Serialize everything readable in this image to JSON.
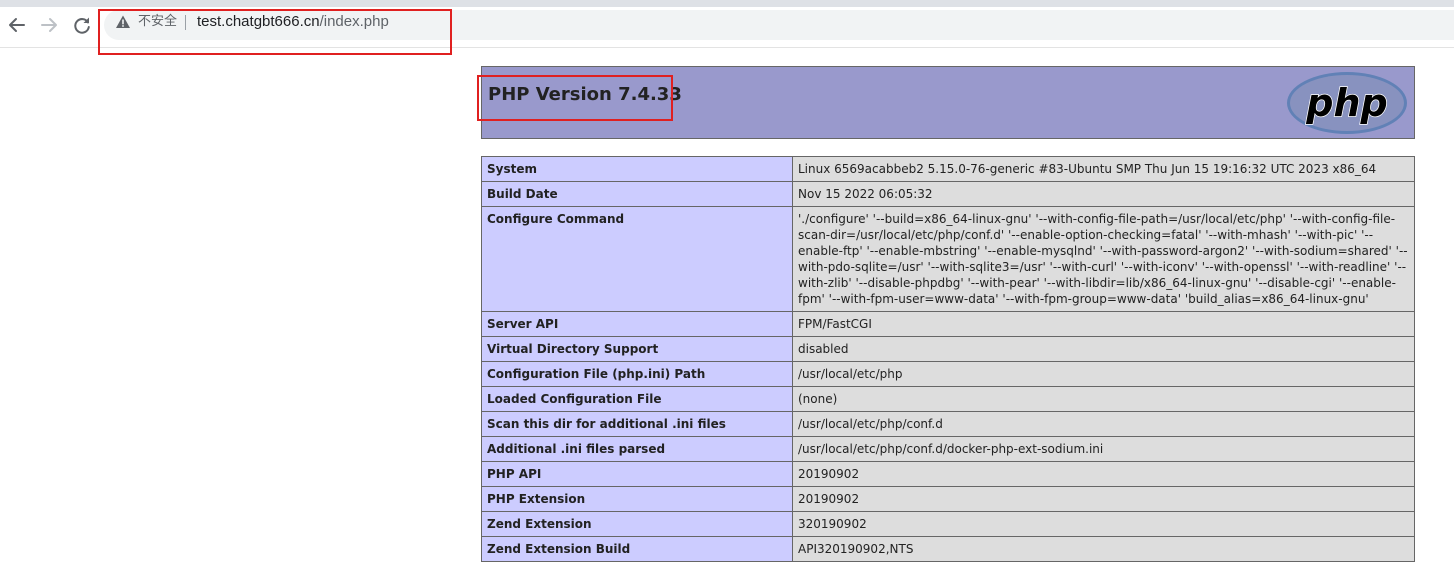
{
  "browser": {
    "security_label": "不安全",
    "url_host": "test.chatgbt666.cn",
    "url_path": "/index.php",
    "nav_icons": [
      "back-arrow-icon",
      "forward-arrow-icon",
      "reload-icon"
    ],
    "warning_icon": "warning-triangle-icon"
  },
  "page": {
    "title": "PHP Version 7.4.33",
    "logo_text": "php",
    "colors": {
      "header_bg": "#9999cc",
      "label_cell_bg": "#ccccff",
      "value_cell_bg": "#dddddd",
      "annotation_red": "#e02020"
    },
    "rows": [
      {
        "label": "System",
        "value": "Linux 6569acabbeb2 5.15.0-76-generic #83-Ubuntu SMP Thu Jun 15 19:16:32 UTC 2023 x86_64"
      },
      {
        "label": "Build Date",
        "value": "Nov 15 2022 06:05:32"
      },
      {
        "label": "Configure Command",
        "value": "'./configure' '--build=x86_64-linux-gnu' '--with-config-file-path=/usr/local/etc/php' '--with-config-file-scan-dir=/usr/local/etc/php/conf.d' '--enable-option-checking=fatal' '--with-mhash' '--with-pic' '--enable-ftp' '--enable-mbstring' '--enable-mysqlnd' '--with-password-argon2' '--with-sodium=shared' '--with-pdo-sqlite=/usr' '--with-sqlite3=/usr' '--with-curl' '--with-iconv' '--with-openssl' '--with-readline' '--with-zlib' '--disable-phpdbg' '--with-pear' '--with-libdir=lib/x86_64-linux-gnu' '--disable-cgi' '--enable-fpm' '--with-fpm-user=www-data' '--with-fpm-group=www-data' 'build_alias=x86_64-linux-gnu'"
      },
      {
        "label": "Server API",
        "value": "FPM/FastCGI"
      },
      {
        "label": "Virtual Directory Support",
        "value": "disabled"
      },
      {
        "label": "Configuration File (php.ini) Path",
        "value": "/usr/local/etc/php"
      },
      {
        "label": "Loaded Configuration File",
        "value": "(none)"
      },
      {
        "label": "Scan this dir for additional .ini files",
        "value": "/usr/local/etc/php/conf.d"
      },
      {
        "label": "Additional .ini files parsed",
        "value": "/usr/local/etc/php/conf.d/docker-php-ext-sodium.ini"
      },
      {
        "label": "PHP API",
        "value": "20190902"
      },
      {
        "label": "PHP Extension",
        "value": "20190902"
      },
      {
        "label": "Zend Extension",
        "value": "320190902"
      },
      {
        "label": "Zend Extension Build",
        "value": "API320190902,NTS"
      }
    ]
  }
}
